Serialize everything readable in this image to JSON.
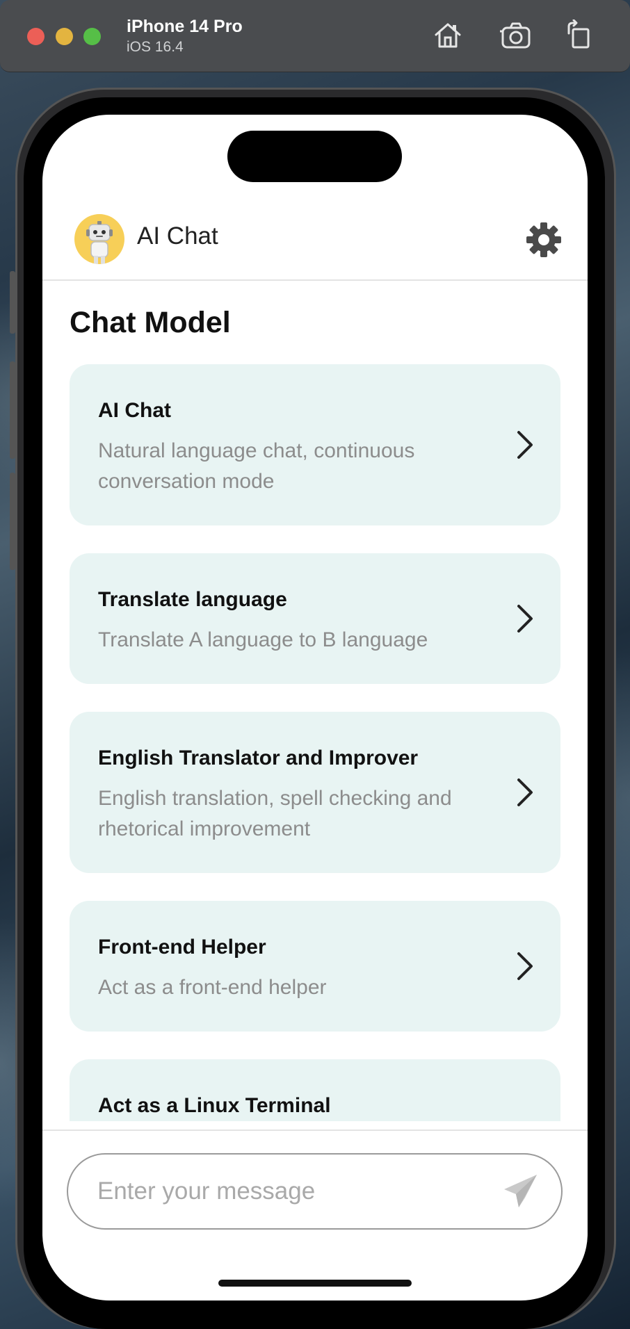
{
  "simulator": {
    "device_name": "iPhone 14 Pro",
    "os_version": "iOS 16.4",
    "icons": [
      "home-icon",
      "screenshot-icon",
      "rotate-icon"
    ]
  },
  "app": {
    "title": "AI Chat",
    "avatar_icon": "robot-avatar",
    "settings_icon": "gear-icon"
  },
  "section_title": "Chat Model",
  "models": [
    {
      "title": "AI Chat",
      "description": "Natural language chat, continuous conversation mode"
    },
    {
      "title": "Translate language",
      "description": "Translate A language to B language"
    },
    {
      "title": "English Translator and Improver",
      "description": "English translation, spell checking and rhetorical improvement"
    },
    {
      "title": "Front-end Helper",
      "description": "Act as a front-end helper"
    },
    {
      "title": "Act as a Linux Terminal",
      "description": ""
    }
  ],
  "composer": {
    "placeholder": "Enter your message",
    "send_icon": "send-icon"
  },
  "colors": {
    "card_background": "#e8f4f3",
    "avatar_background": "#f7cf58",
    "accent_text": "#111111",
    "muted_text": "#8c8c8c"
  }
}
